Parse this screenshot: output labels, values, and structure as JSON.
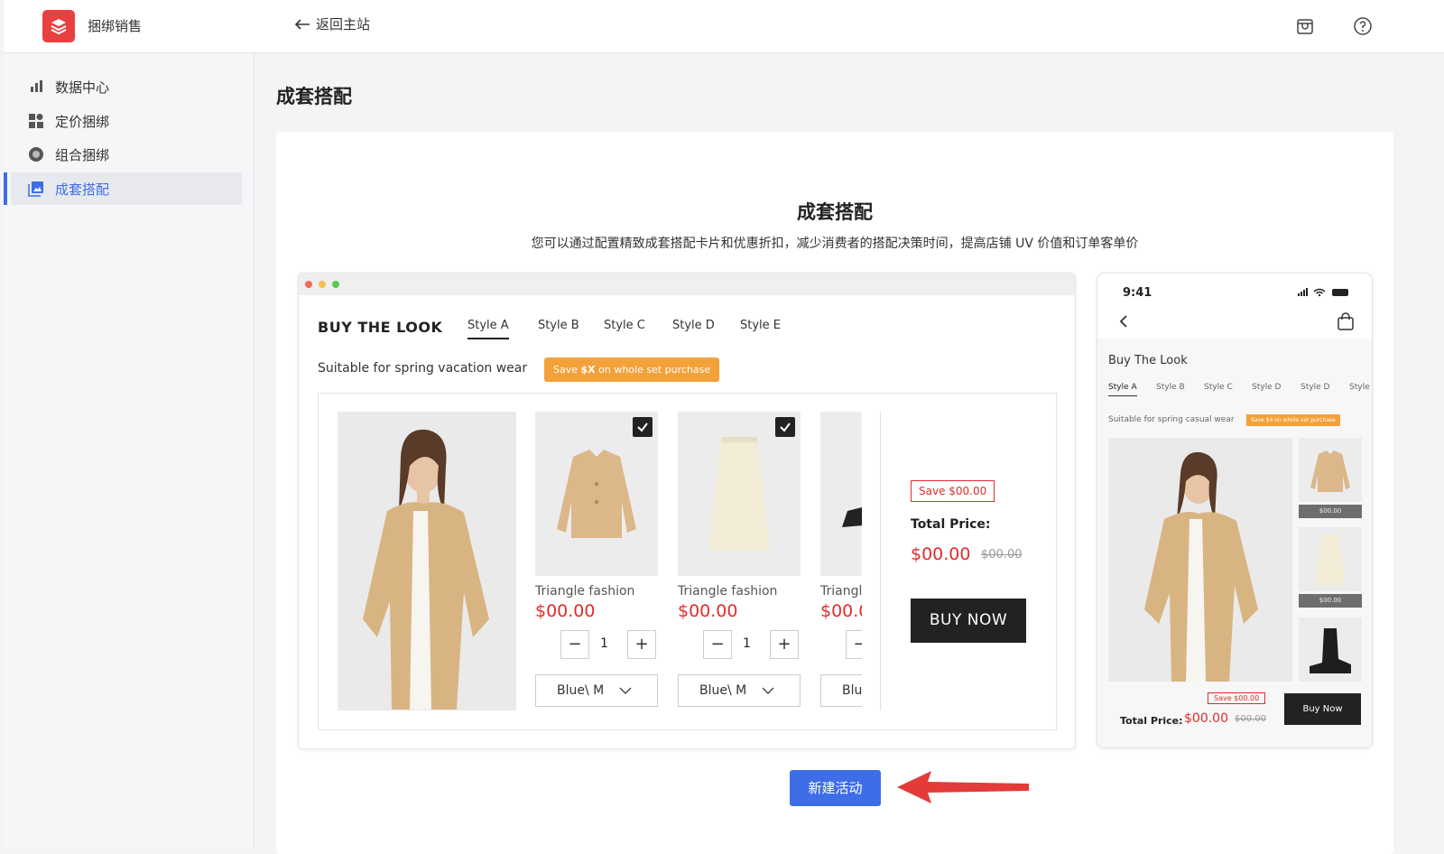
{
  "app": {
    "name": "捆绑销售",
    "back_label": "返回主站"
  },
  "sidebar": {
    "items": [
      {
        "label": "数据中心",
        "icon": "bar-chart-icon"
      },
      {
        "label": "定价捆绑",
        "icon": "grid-icon"
      },
      {
        "label": "组合捆绑",
        "icon": "circle-icon"
      },
      {
        "label": "成套搭配",
        "icon": "image-icon",
        "active": true
      }
    ]
  },
  "page": {
    "title": "成套搭配"
  },
  "intro": {
    "title": "成套搭配",
    "subtitle": "您可以通过配置精致成套搭配卡片和优惠折扣，减少消费者的搭配决策时间，提高店铺 UV 价值和订单客单价"
  },
  "desktop_preview": {
    "heading": "BUY THE LOOK",
    "tabs": [
      "Style A",
      "Style B",
      "Style C",
      "Style D",
      "Style E"
    ],
    "suit_text": "Suitable for spring vacation wear",
    "badge": {
      "pre": "Save ",
      "bold": "$X",
      "post": " on whole set purchase"
    },
    "products": [
      {
        "name": "Triangle fashion",
        "price": "$00.00",
        "qty": "1",
        "option": "Blue\\ M"
      },
      {
        "name": "Triangle fashion",
        "price": "$00.00",
        "qty": "1",
        "option": "Blue\\ M"
      },
      {
        "name": "Triangle",
        "price": "$00.0",
        "qty": "",
        "option": "Blu"
      }
    ],
    "save": "Save $00.00",
    "total_label": "Total Price:",
    "total": "$00.00",
    "total_old": "$00.00",
    "buy": "BUY NOW"
  },
  "mobile_preview": {
    "time": "9:41",
    "title": "Buy The Look",
    "tabs": [
      "Style A",
      "Style B",
      "Style C",
      "Style D",
      "Style D",
      "Style"
    ],
    "suit_text": "Suitable for spring casual wear",
    "badge": "Save $4 on whole set purchase",
    "thumb_price_1": "$00.00",
    "thumb_price_2": "$00.00",
    "save": "Save $00.00",
    "total_label": "Total Price:",
    "total": "$00.00",
    "total_old": "$00.00",
    "buy": "Buy Now"
  },
  "action": {
    "new_label": "新建活动"
  },
  "colors": {
    "accent": "#3d6ee8",
    "price": "#e32b2b",
    "badge": "#f4a13a",
    "logo": "#e84040"
  }
}
